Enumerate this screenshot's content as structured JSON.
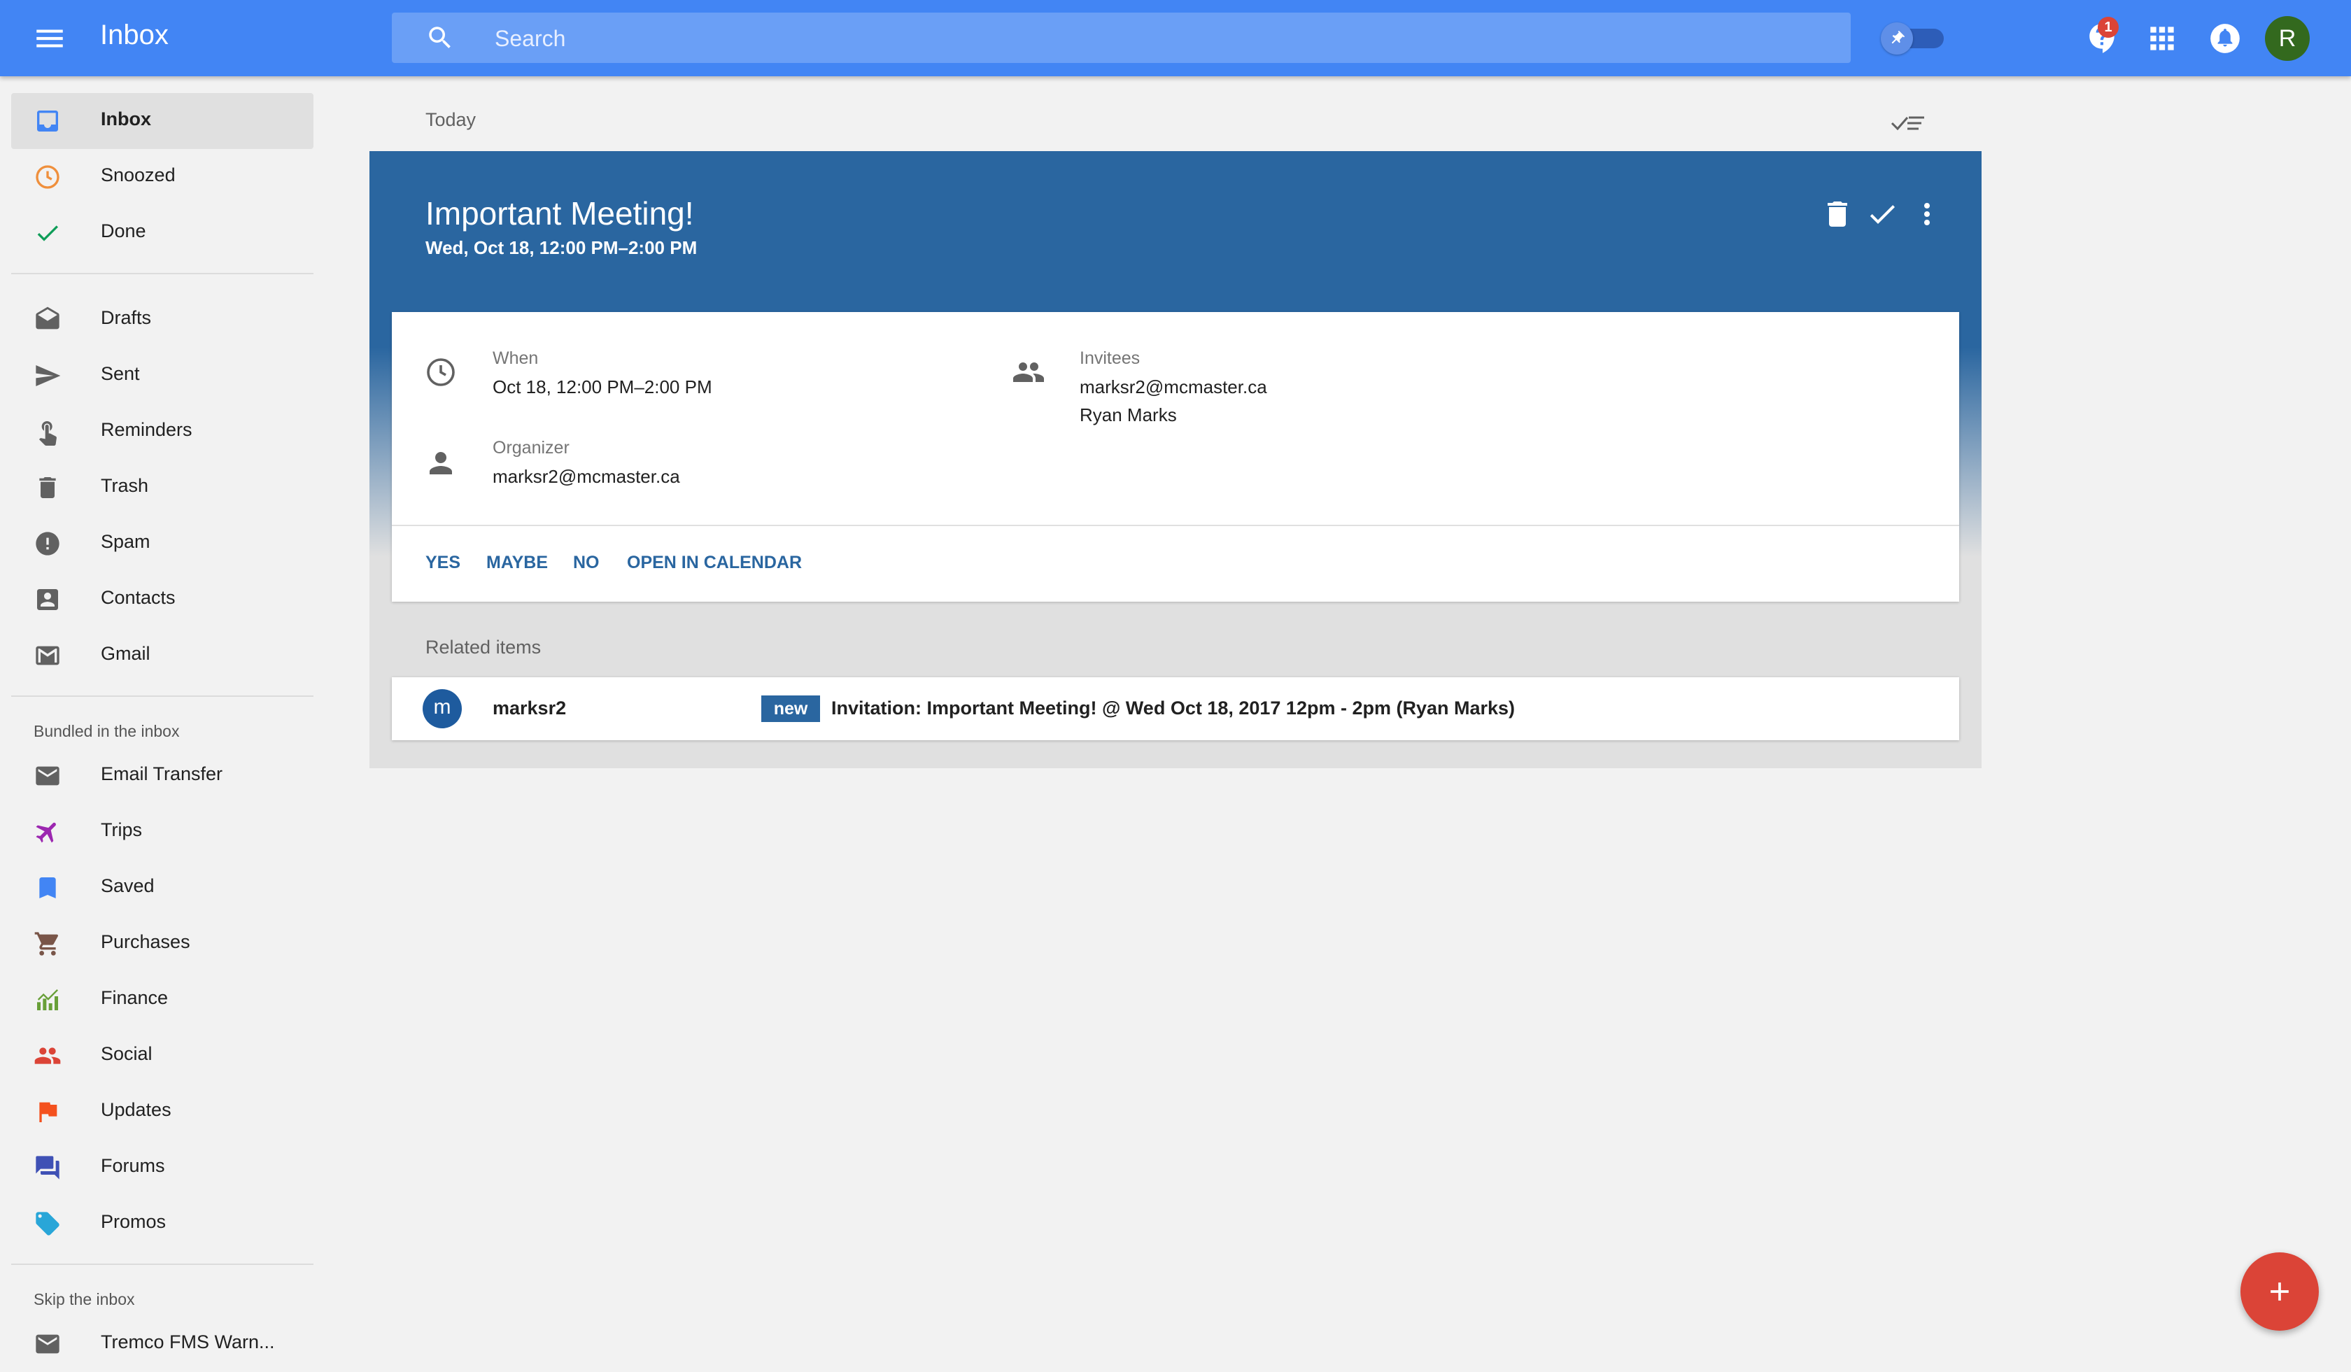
{
  "app": {
    "title": "Inbox",
    "accent_color": "#4285f4",
    "search_placeholder": "Search",
    "notification_count": "1",
    "avatar_initial": "R",
    "icons": [
      "menu-icon",
      "search-icon",
      "pin-icon",
      "help-feedback-icon",
      "apps-grid-icon",
      "notifications-bell-icon",
      "avatar"
    ]
  },
  "sidebar": {
    "main_items": [
      {
        "label": "Inbox",
        "icon": "inbox-icon",
        "active": true
      },
      {
        "label": "Snoozed",
        "icon": "clock-icon"
      },
      {
        "label": "Done",
        "icon": "check-icon"
      }
    ],
    "folder_items": [
      {
        "label": "Drafts",
        "icon": "drafts-icon"
      },
      {
        "label": "Sent",
        "icon": "send-icon"
      },
      {
        "label": "Reminders",
        "icon": "reminder-hand-icon"
      },
      {
        "label": "Trash",
        "icon": "trash-icon"
      },
      {
        "label": "Spam",
        "icon": "spam-icon"
      },
      {
        "label": "Contacts",
        "icon": "contacts-icon"
      },
      {
        "label": "Gmail",
        "icon": "gmail-icon"
      }
    ],
    "bundled_label": "Bundled in the inbox",
    "bundled_items": [
      {
        "label": "Email Transfer",
        "icon": "mail-icon"
      },
      {
        "label": "Trips",
        "icon": "airplane-icon"
      },
      {
        "label": "Saved",
        "icon": "bookmark-icon"
      },
      {
        "label": "Purchases",
        "icon": "cart-icon"
      },
      {
        "label": "Finance",
        "icon": "finance-chart-icon"
      },
      {
        "label": "Social",
        "icon": "people-icon"
      },
      {
        "label": "Updates",
        "icon": "flag-icon"
      },
      {
        "label": "Forums",
        "icon": "forum-icon"
      },
      {
        "label": "Promos",
        "icon": "tag-icon"
      }
    ],
    "skip_label": "Skip the inbox",
    "skip_items": [
      {
        "label": "Tremco FMS Warn...",
        "icon": "mail-icon"
      }
    ]
  },
  "main": {
    "day_label": "Today",
    "card": {
      "header_color": "#2a66a0",
      "title": "Important Meeting!",
      "subtitle": "Wed, Oct 18, 12:00 PM–2:00 PM",
      "when_label": "When",
      "when_value": "Oct 18, 12:00 PM–2:00 PM",
      "organizer_label": "Organizer",
      "organizer_value": "marksr2@mcmaster.ca",
      "invitees_label": "Invitees",
      "invitees": [
        "marksr2@mcmaster.ca",
        "Ryan Marks"
      ],
      "actions": [
        "YES",
        "MAYBE",
        "NO",
        "OPEN IN CALENDAR"
      ]
    },
    "related": {
      "label": "Related items",
      "item": {
        "avatar_initial": "m",
        "sender": "marksr2",
        "badge": "new",
        "subject": "Invitation: Important Meeting! @ Wed Oct 18, 2017 12pm - 2pm (Ryan Marks)"
      }
    },
    "fab_color": "#db4437"
  }
}
